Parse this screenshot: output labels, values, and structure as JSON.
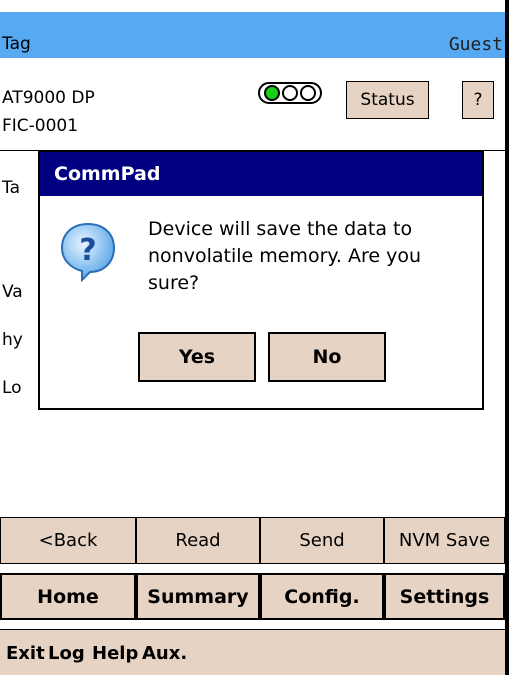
{
  "titlebar": {
    "tag": "Tag",
    "user": "Guest"
  },
  "device": {
    "model": "AT9000 DP",
    "tag_id": "FIC-0001",
    "status_label": "Status",
    "help_label": "?"
  },
  "background_fragments": [
    "Ta",
    "Va",
    "hy",
    "Lo"
  ],
  "dialog": {
    "title": "CommPad",
    "message": "Device will save the data to nonvolatile memory. Are you sure?",
    "yes_label": "Yes",
    "no_label": "No",
    "icon": "question-icon"
  },
  "actions": [
    "<Back",
    "Read",
    "Send",
    "NVM Save"
  ],
  "nav": [
    "Home",
    "Summary",
    "Config.",
    "Settings"
  ],
  "menu": [
    "Exit",
    "Log",
    "Help",
    "Aux."
  ],
  "colors": {
    "titlebar": "#57a9f2",
    "dialog_title": "#000080",
    "button": "#e6d3c3"
  }
}
